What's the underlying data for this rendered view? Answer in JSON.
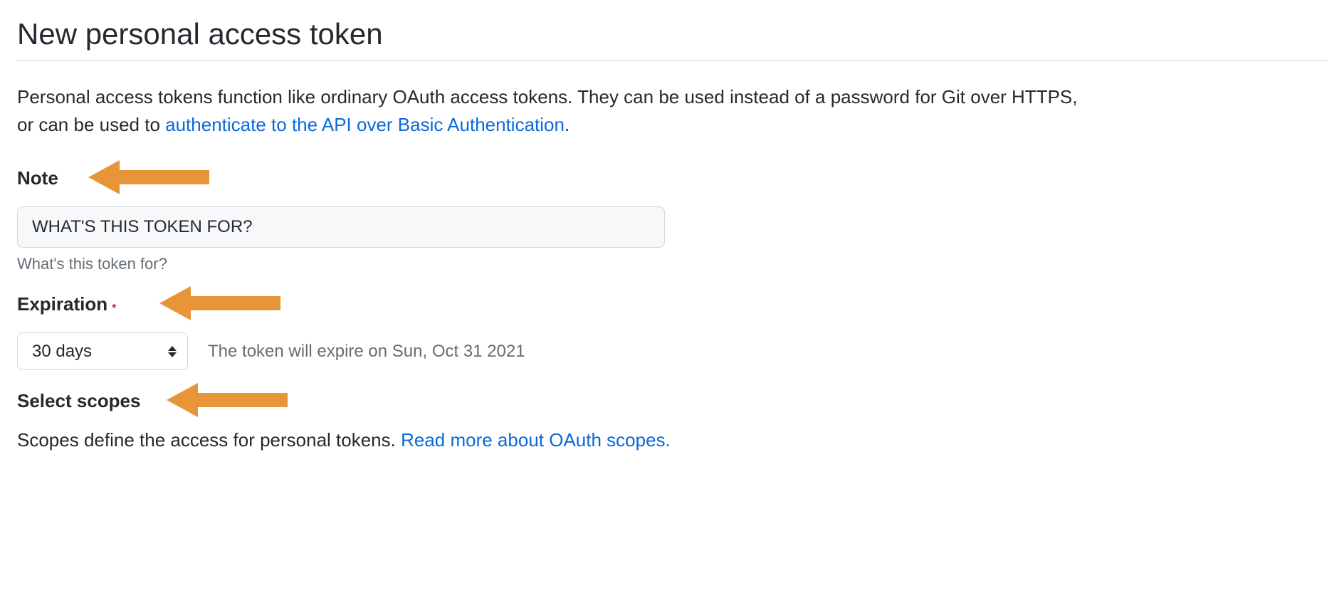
{
  "page": {
    "title": "New personal access token"
  },
  "description": {
    "text_before_link": "Personal access tokens function like ordinary OAuth access tokens. They can be used instead of a password for Git over HTTPS, or can be used to ",
    "link_text": "authenticate to the API over Basic Authentication",
    "text_after_link": "."
  },
  "note": {
    "label": "Note",
    "value": "WHAT'S THIS TOKEN FOR?",
    "help": "What's this token for?"
  },
  "expiration": {
    "label": "Expiration",
    "required": "*",
    "selected": "30 days",
    "info": "The token will expire on Sun, Oct 31 2021"
  },
  "scopes": {
    "label": "Select scopes",
    "description_before_link": "Scopes define the access for personal tokens. ",
    "link_text": "Read more about OAuth scopes."
  },
  "annotation_color": "#e8953a"
}
